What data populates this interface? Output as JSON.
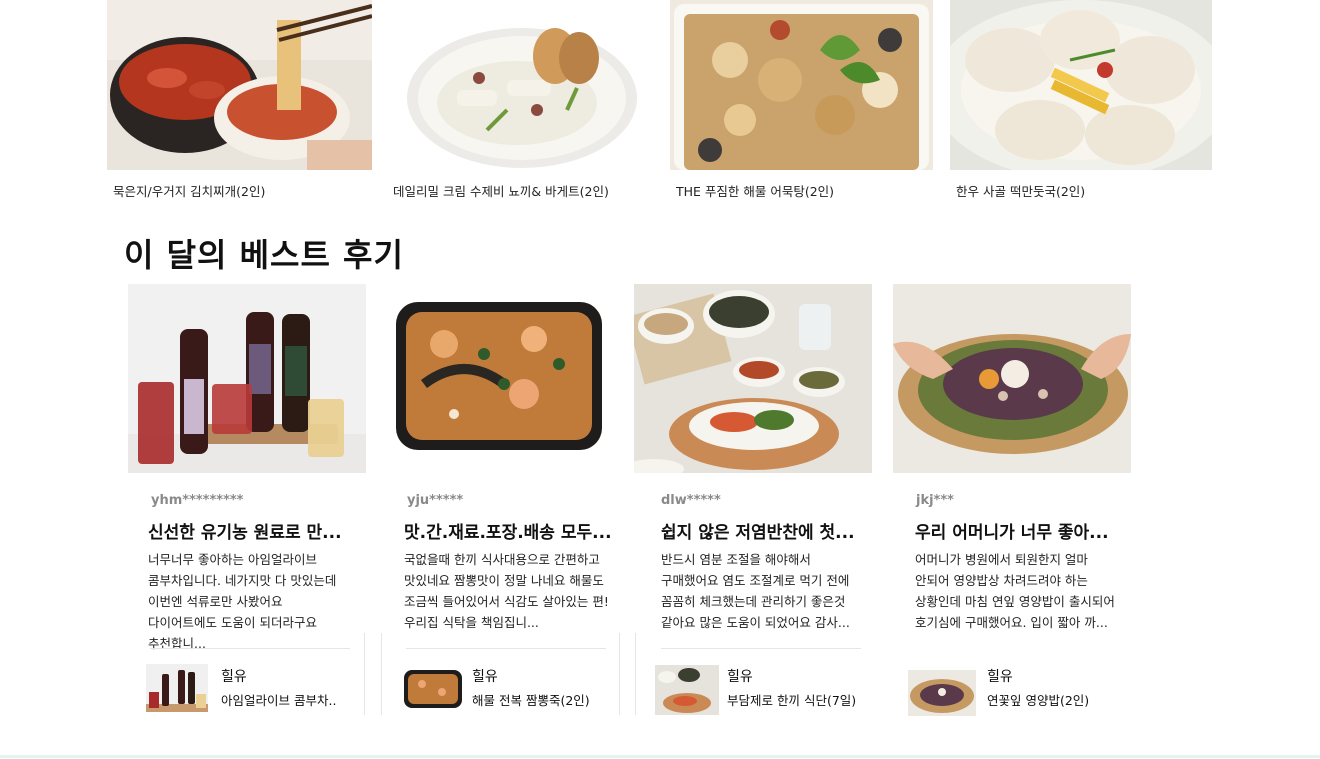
{
  "products": [
    {
      "name": "묵은지/우거지 김치찌개(2인)",
      "image": "kimchi-stew-image"
    },
    {
      "name": "데일리밀 크림 수제비 뇨끼& 바게트(2인)",
      "image": "cream-sujebi-image"
    },
    {
      "name": "THE 푸짐한 해물 어묵탕(2인)",
      "image": "fishcake-soup-image"
    },
    {
      "name": "한우 사골 떡만둣국(2인)",
      "image": "dumpling-soup-image"
    }
  ],
  "reviews_section": {
    "title": "이 달의 베스트 후기",
    "items": [
      {
        "user": "yhm*********",
        "title": "신선한 유기농 원료로 만...",
        "body": "너무너무 좋아하는 아임얼라이브 콤부차입니다. 네가지맛 다 맛있는데 이번엔 석류로만 사봤어요 다이어트에도 도움이 되더라구요 추천합니...",
        "seller": "힐유",
        "product": "아임얼라이브 콤부차.."
      },
      {
        "user": "yju*****",
        "title": "맛.간.재료.포장.배송 모두...",
        "body": "국없을때 한끼 식사대용으로 간편하고 맛있네요 짬뽕맛이 정말 나네요 해물도 조금씩 들어있어서 식감도 살아있는 편! 우리집 식탁을 책임집니...",
        "seller": "힐유",
        "product": "해물 전복 짬뽕죽(2인)"
      },
      {
        "user": "dlw*****",
        "title": "쉽지 않은 저염반찬에 첫...",
        "body": "반드시 염분 조절을 해야해서 구매했어요 염도 조절계로 먹기 전에 꼼꼼히 체크했는데 관리하기 좋은것 같아요 많은 도움이 되었어요 감사...",
        "seller": "힐유",
        "product": "부담제로 한끼 식단(7일)"
      },
      {
        "user": "jkj***",
        "title": "우리 어머니가 너무 좋아...",
        "body": "어머니가 병원에서 퇴원한지 얼마 안되어 영양밥상 차려드려야 하는 상황인데 마침 연잎 영양밥이 출시되어 호기심에 구매했어요. 입이 짧아 까...",
        "seller": "힐유",
        "product": "연꽃잎 영양밥(2인)"
      }
    ]
  }
}
